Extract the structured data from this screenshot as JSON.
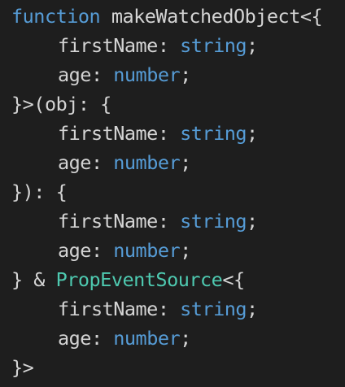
{
  "code": {
    "l1": {
      "keyword": "function",
      "name": " makeWatchedObject<{"
    },
    "l2": {
      "prop": "firstName: ",
      "type": "string",
      "end": ";"
    },
    "l3": {
      "prop": "age: ",
      "type": "number",
      "end": ";"
    },
    "l4": {
      "text": "}>(obj: {"
    },
    "l5": {
      "prop": "firstName: ",
      "type": "string",
      "end": ";"
    },
    "l6": {
      "prop": "age: ",
      "type": "number",
      "end": ";"
    },
    "l7": {
      "text": "}): {"
    },
    "l8": {
      "prop": "firstName: ",
      "type": "string",
      "end": ";"
    },
    "l9": {
      "prop": "age: ",
      "type": "number",
      "end": ";"
    },
    "l10": {
      "pre": "} & ",
      "cls": "PropEventSource",
      "post": "<{"
    },
    "l11": {
      "prop": "firstName: ",
      "type": "string",
      "end": ";"
    },
    "l12": {
      "prop": "age: ",
      "type": "number",
      "end": ";"
    },
    "l13": {
      "text": "}>"
    }
  },
  "colors": {
    "background": "#1e1e1e",
    "keyword": "#569cd6",
    "type": "#569cd6",
    "class": "#4ec9b0",
    "text": "#d4d4d4"
  }
}
